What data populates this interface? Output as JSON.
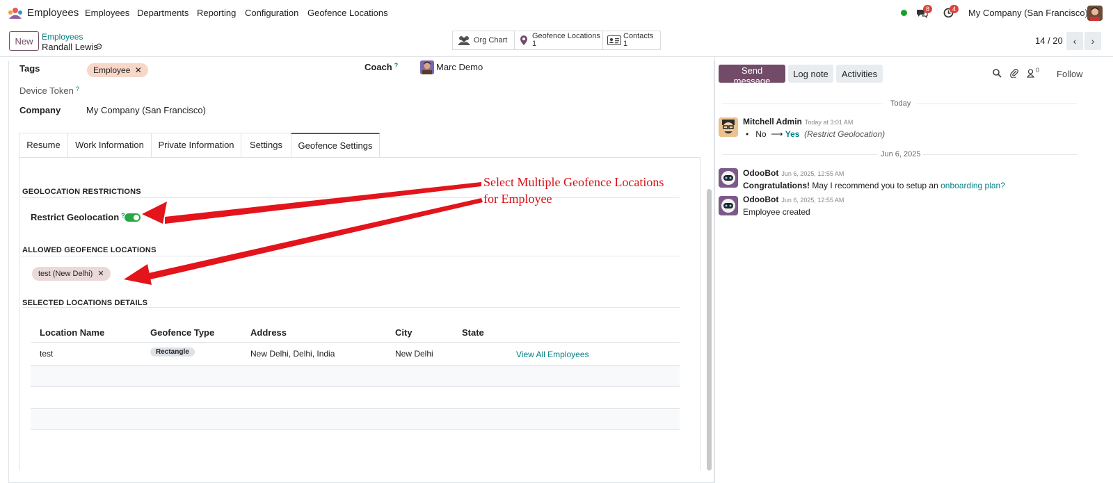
{
  "topnav": {
    "app_name": "Employees",
    "menu": [
      "Employees",
      "Departments",
      "Reporting",
      "Configuration",
      "Geofence Locations"
    ],
    "messages_count": "8",
    "activities_count": "4",
    "company": "My Company (San Francisco)"
  },
  "control": {
    "new_label": "New",
    "breadcrumb_parent": "Employees",
    "breadcrumb_current": "Randall Lewis",
    "smart_buttons": {
      "org_chart": "Org Chart",
      "geofence_label": "Geofence Locations",
      "geofence_count": "1",
      "contacts_label": "Contacts",
      "contacts_count": "1"
    },
    "pager": "14 / 20"
  },
  "form": {
    "tags_label": "Tags",
    "tag_value": "Employee",
    "coach_label": "Coach",
    "coach_value": "Marc Demo",
    "device_token_label": "Device Token",
    "company_label": "Company",
    "company_value": "My Company (San Francisco)",
    "tabs": [
      "Resume",
      "Work Information",
      "Private Information",
      "Settings",
      "Geofence Settings"
    ],
    "sec_restrictions": "GEOLOCATION RESTRICTIONS",
    "restrict_label": "Restrict Geolocation",
    "restrict_enabled": true,
    "sec_allowed": "ALLOWED GEOFENCE LOCATIONS",
    "allowed_tag": "test (New Delhi)",
    "sec_details": "SELECTED LOCATIONS DETAILS",
    "table": {
      "headers": [
        "Location Name",
        "Geofence Type",
        "Address",
        "City",
        "State"
      ],
      "row": {
        "name": "test",
        "type": "Rectangle",
        "address": "New Delhi, Delhi, India",
        "city": "New Delhi",
        "state": "",
        "action": "View All Employees"
      }
    }
  },
  "annotation": {
    "line1": "Select Multiple Geofence Locations",
    "line2": "for Employee",
    "color": "#d80f16"
  },
  "chatter": {
    "send_message": "Send message",
    "log_note": "Log note",
    "activities": "Activities",
    "followers_count": "0",
    "follow": "Follow",
    "day1": "Today",
    "msg1_author": "Mitchell Admin",
    "msg1_time": "Today at 3:01 AM",
    "msg1_old": "No",
    "msg1_new": "Yes",
    "msg1_field": "(Restrict Geolocation)",
    "day2": "Jun 6, 2025",
    "msg2_author": "OdooBot",
    "msg2_time": "Jun 6, 2025, 12:55 AM",
    "msg2_bold": "Congratulations!",
    "msg2_text": "May I recommend you to setup an",
    "msg2_link": "onboarding plan?",
    "msg3_author": "OdooBot",
    "msg3_time": "Jun 6, 2025, 12:55 AM",
    "msg3_text": "Employee created"
  },
  "colors": {
    "brand": "#714b67",
    "link": "#017e84",
    "toggle_on": "#28a745",
    "tag_employee_bg": "#f7d7c7",
    "tag_location_bg": "#ead9d9"
  }
}
